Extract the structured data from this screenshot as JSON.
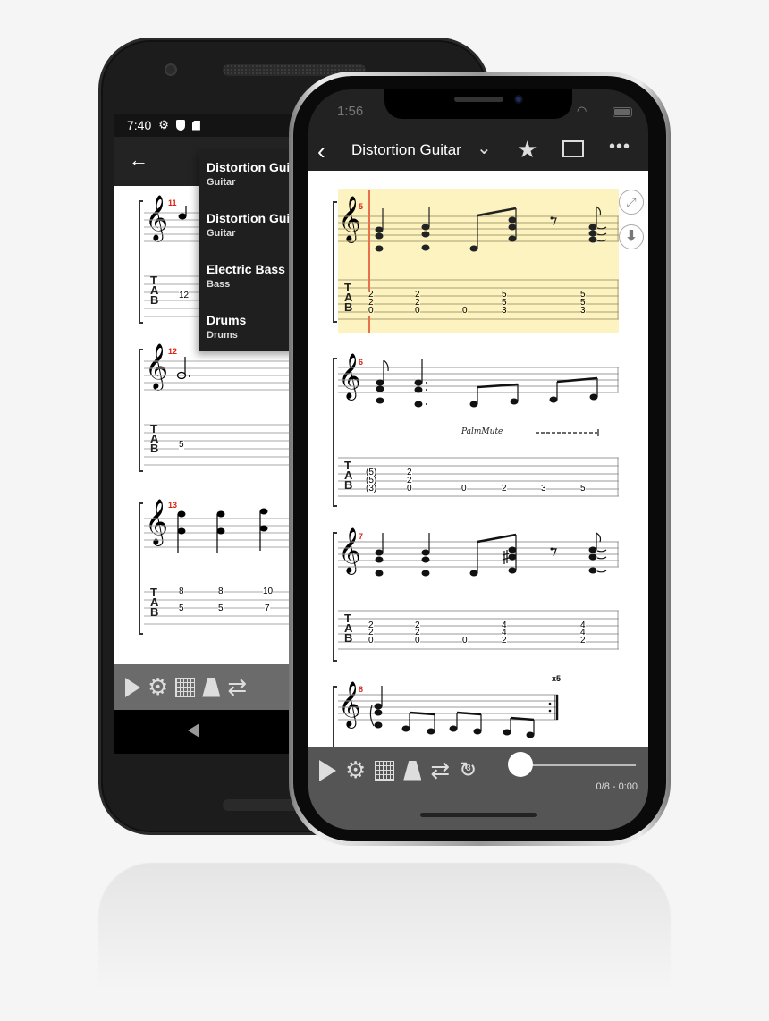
{
  "android": {
    "status": {
      "time": "7:40",
      "icons": [
        "gear-icon",
        "shield-icon",
        "sd-card-icon"
      ]
    },
    "back_icon": "←",
    "track_menu": [
      {
        "name": "Distortion Guitar",
        "type": "Guitar"
      },
      {
        "name": "Distortion Guitar",
        "type": "Guitar"
      },
      {
        "name": "Electric Bass",
        "type": "Bass"
      },
      {
        "name": "Drums",
        "type": "Drums"
      }
    ],
    "measures": [
      {
        "number": "11",
        "tab": [
          [
            "",
            "",
            "12",
            ""
          ]
        ]
      },
      {
        "number": "12",
        "tab": [
          [
            "",
            "",
            "5",
            ""
          ]
        ]
      },
      {
        "number": "13",
        "tab": [
          [
            "8",
            "5"
          ],
          [
            "8",
            "5"
          ],
          [
            "10",
            "7"
          ]
        ]
      }
    ],
    "toolbar_icons": [
      "play-icon",
      "gear-icon",
      "fretboard-icon",
      "metronome-icon",
      "loop-icon"
    ],
    "nav_back_icon": "◀"
  },
  "iphone": {
    "status": {
      "time": "1:56"
    },
    "header": {
      "back": "‹",
      "title": "Distortion Guitar",
      "chevron": "⌄",
      "star": "★",
      "more": "•••"
    },
    "tab_letters": [
      "T",
      "A",
      "B"
    ],
    "measures": [
      {
        "number": "5",
        "highlighted": true,
        "tab": [
          [
            "2",
            "2",
            "0"
          ],
          [
            "2",
            "2",
            "0"
          ],
          [
            "",
            "",
            "0"
          ],
          [
            "5",
            "5",
            "3"
          ],
          [
            "5",
            "5",
            "3"
          ]
        ]
      },
      {
        "number": "6",
        "annotation": "PalmMute",
        "tab": [
          [
            "(5)",
            "(5)",
            "(3)"
          ],
          [
            "2",
            "2",
            "0"
          ],
          [
            "",
            "",
            "0"
          ],
          [
            "",
            "",
            "2"
          ],
          [
            "",
            "",
            "3"
          ],
          [
            "",
            "",
            "5"
          ]
        ]
      },
      {
        "number": "7",
        "tab": [
          [
            "2",
            "2",
            "0"
          ],
          [
            "2",
            "2",
            "0"
          ],
          [
            "",
            "",
            "0"
          ],
          [
            "4",
            "4",
            "2"
          ],
          [
            "4",
            "4",
            "2"
          ]
        ]
      },
      {
        "number": "8",
        "repeat": "x5"
      }
    ],
    "side_buttons": [
      "expand-icon",
      "download-icon"
    ],
    "toolbar": {
      "icons": [
        "play-icon",
        "gear-icon",
        "fretboard-icon",
        "metronome-icon",
        "loop-icon",
        "countdown-icon"
      ],
      "countdown": "3",
      "progress": 0,
      "position_text": "0/8 - 0:00"
    }
  }
}
